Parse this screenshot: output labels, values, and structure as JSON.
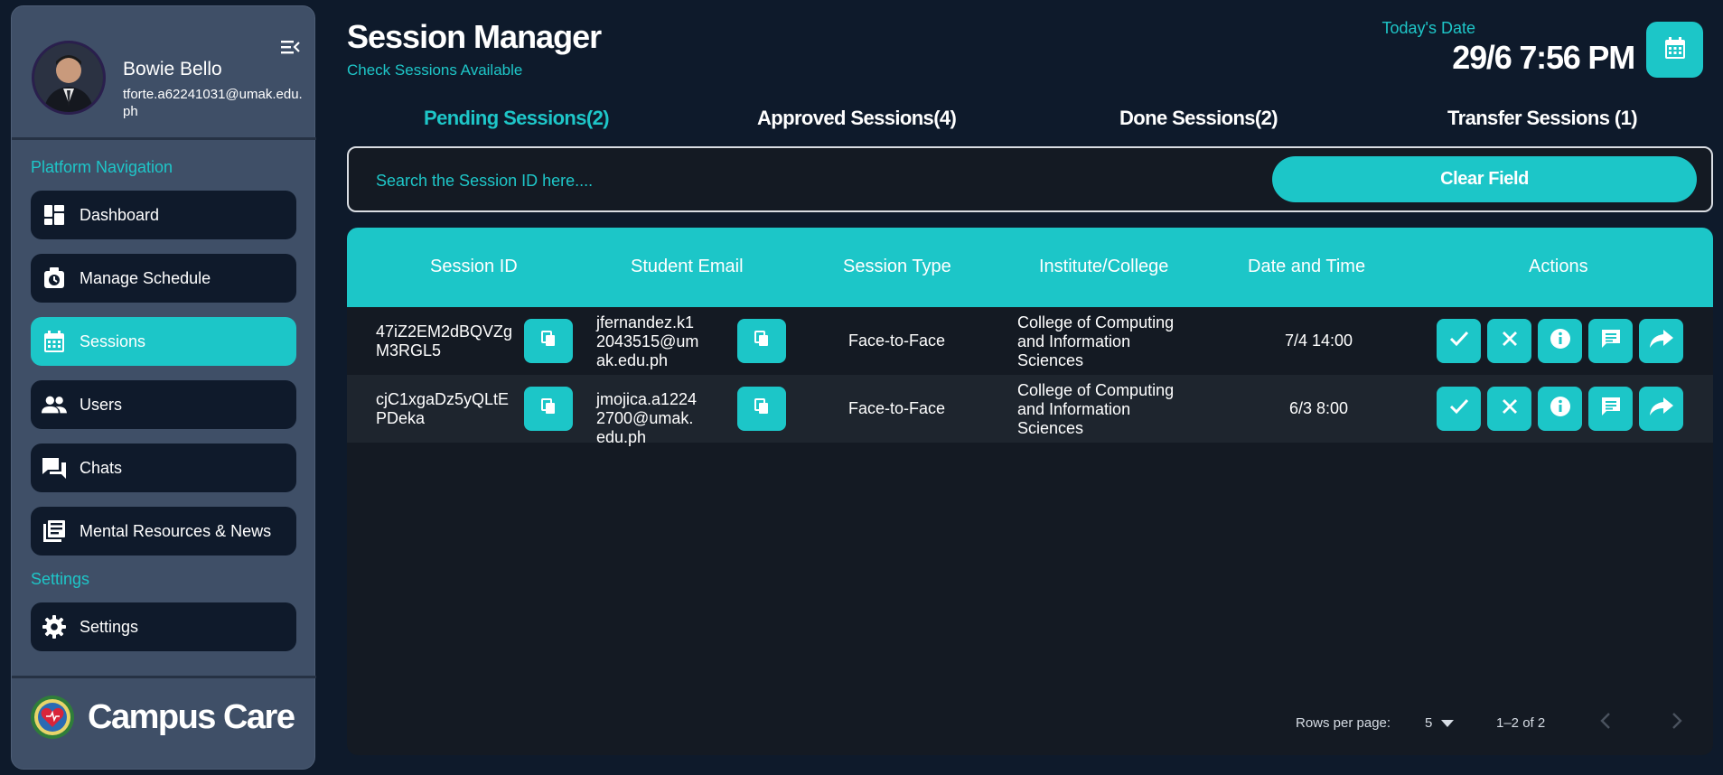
{
  "profile": {
    "name": "Bowie Bello",
    "email": "tforte.a62241031@umak.edu.ph"
  },
  "sidebar": {
    "section_navigation": "Platform Navigation",
    "section_settings": "Settings",
    "items": [
      {
        "label": "Dashboard",
        "icon": "dashboard-icon"
      },
      {
        "label": "Manage Schedule",
        "icon": "schedule-icon"
      },
      {
        "label": "Sessions",
        "icon": "calendar-icon",
        "active": true
      },
      {
        "label": "Users",
        "icon": "users-icon"
      },
      {
        "label": "Chats",
        "icon": "chats-icon"
      },
      {
        "label": "Mental Resources & News",
        "icon": "news-icon"
      }
    ],
    "settings_item": {
      "label": "Settings",
      "icon": "gear-icon"
    },
    "brand": "Campus Care"
  },
  "header": {
    "title": "Session Manager",
    "subtitle": "Check Sessions Available",
    "date_label": "Today's Date",
    "date_value": "29/6 7:56 PM"
  },
  "tabs": [
    {
      "label": "Pending Sessions(2)",
      "active": true
    },
    {
      "label": "Approved Sessions(4)"
    },
    {
      "label": "Done Sessions(2)"
    },
    {
      "label": "Transfer Sessions (1)"
    }
  ],
  "search": {
    "placeholder": "Search the Session ID here....",
    "value": "",
    "clear_label": "Clear Field"
  },
  "table": {
    "columns": [
      "Session ID",
      "Student Email",
      "Session Type",
      "Institute/College",
      "Date and Time",
      "Actions"
    ],
    "rows": [
      {
        "session_id": "47iZ2EM2dBQVZgM3RGL5",
        "email": "jfernandez.k12043515@umak.edu.ph",
        "type": "Face-to-Face",
        "college": "College of Computing and Information Sciences",
        "datetime": "7/4 14:00"
      },
      {
        "session_id": "cjC1xgaDz5yQLtEPDeka",
        "email": "jmojica.a12242700@umak.edu.ph",
        "type": "Face-to-Face",
        "college": "College of Computing and Information Sciences",
        "datetime": "6/3 8:00"
      }
    ],
    "actions": [
      "approve-icon",
      "reject-icon",
      "info-icon",
      "message-icon",
      "transfer-icon"
    ]
  },
  "pagination": {
    "rows_per_page_label": "Rows per page:",
    "rows_per_page": "5",
    "range": "1–2 of 2"
  },
  "colors": {
    "accent": "#1cc6c8",
    "background": "#0e1a2b",
    "sidebar": "#3f4f67",
    "card": "#141a23"
  }
}
